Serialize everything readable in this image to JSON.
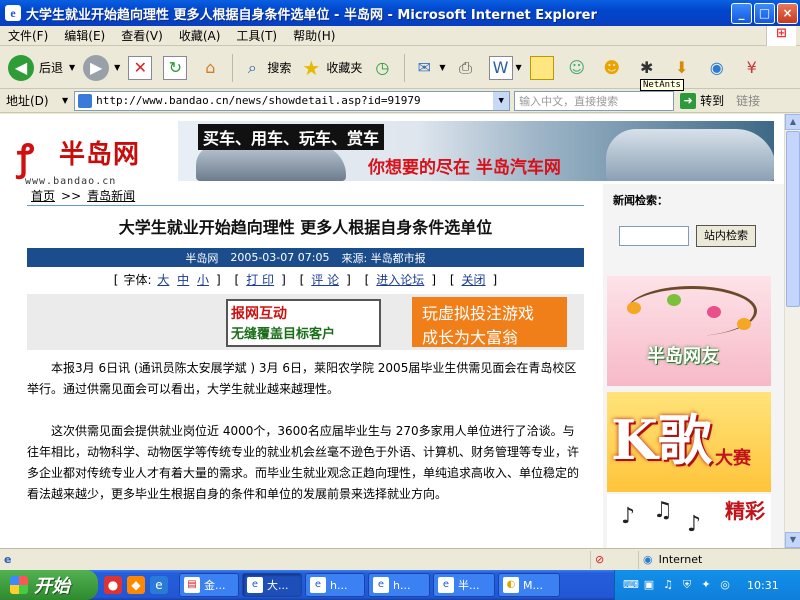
{
  "window": {
    "title": "大学生就业开始趋向理性 更多人根据自身条件选单位 - 半岛网 - Microsoft Internet Explorer"
  },
  "menu": [
    "文件(F)",
    "编辑(E)",
    "查看(V)",
    "收藏(A)",
    "工具(T)",
    "帮助(H)"
  ],
  "toolbar": {
    "back": "后退",
    "search": "搜索",
    "favorites": "收藏夹",
    "tooltip": "NetAnts"
  },
  "addressbar": {
    "label": "地址(D)",
    "url": "http://www.bandao.cn/news/showdetail.asp?id=91979",
    "search_placeholder": "输入中文，直接搜索",
    "go": "转到",
    "links": "链接"
  },
  "site": {
    "logo_name": "半岛网",
    "logo_url": "www.bandao.cn",
    "banner_top": "买车、用车、玩车、赏车",
    "banner_bottom": "你想要的尽在 半岛汽车网"
  },
  "breadcrumb": {
    "home": "首页",
    "sep": ">>",
    "section": "青岛新闻"
  },
  "article": {
    "headline": "大学生就业开始趋向理性  更多人根据自身条件选单位",
    "meta_site": "半岛网",
    "meta_datetime": "2005-03-07  07:05",
    "meta_source": "来源: 半岛都市报",
    "tools_label": "字体:",
    "font_large": "大",
    "font_medium": "中",
    "font_small": "小",
    "print": "打 印",
    "comment": "评 论",
    "forum": "进入论坛",
    "close": "关闭",
    "paragraphs": [
      "本报3月 6日讯 (通讯员陈太安展学斌 ) 3月 6日，莱阳农学院 2005届毕业生供需见面会在青岛校区举行。通过供需见面会可以看出，大学生就业越来越理性。",
      "这次供需见面会提供就业岗位近 4000个，3600名应届毕业生与 270多家用人单位进行了洽谈。与往年相比，动物科学、动物医学等传统专业的就业机会丝毫不逊色于外语、计算机、财务管理等专业，许多企业都对传统专业人才有着大量的需求。而毕业生就业观念正趋向理性，单纯追求高收入、单位稳定的看法越来越少，更多毕业生根据自身的条件和单位的发展前景来选择就业方向。"
    ]
  },
  "ads": {
    "ad1_line1": "报网互动",
    "ad1_line2": "无缝覆盖目标客户",
    "ad2_line1": "玩虚拟投注游戏",
    "ad2_line2": "成长为大富翁"
  },
  "sidebar": {
    "search_label": "新闻检索：",
    "search_button": "站内检索",
    "promo1": "半岛网友",
    "promo2_big": "K歌",
    "promo2_small": "大赛",
    "promo3": "精彩"
  },
  "status": {
    "zone": "Internet"
  },
  "taskbar": {
    "start": "开始",
    "tasks": [
      "金...",
      "大...",
      "h...",
      "h...",
      "半...",
      "M..."
    ],
    "clock": "10:31"
  }
}
